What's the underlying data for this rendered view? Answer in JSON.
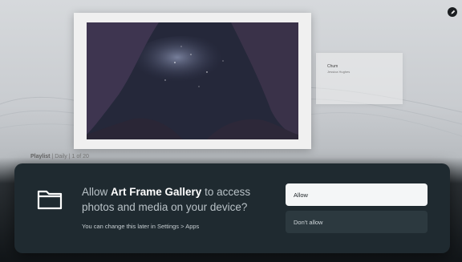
{
  "background": {
    "artwork_description_card": {
      "title": "Chum",
      "subtitle": "Jessica Hughes"
    },
    "playlist": {
      "label": "Playlist",
      "name": "Daily",
      "position": "1 of 20"
    }
  },
  "dialog": {
    "icon": "folder-icon",
    "message_prefix": "Allow ",
    "app_name": "Art Frame Gallery",
    "message_suffix": " to access photos and media on your device?",
    "note": "You can change this later in Settings > Apps",
    "allow_label": "Allow",
    "deny_label": "Don't allow"
  },
  "colors": {
    "dialog_bg": "#1f2a30",
    "allow_bg": "#f4f6f7",
    "deny_bg": "#2c393f"
  }
}
